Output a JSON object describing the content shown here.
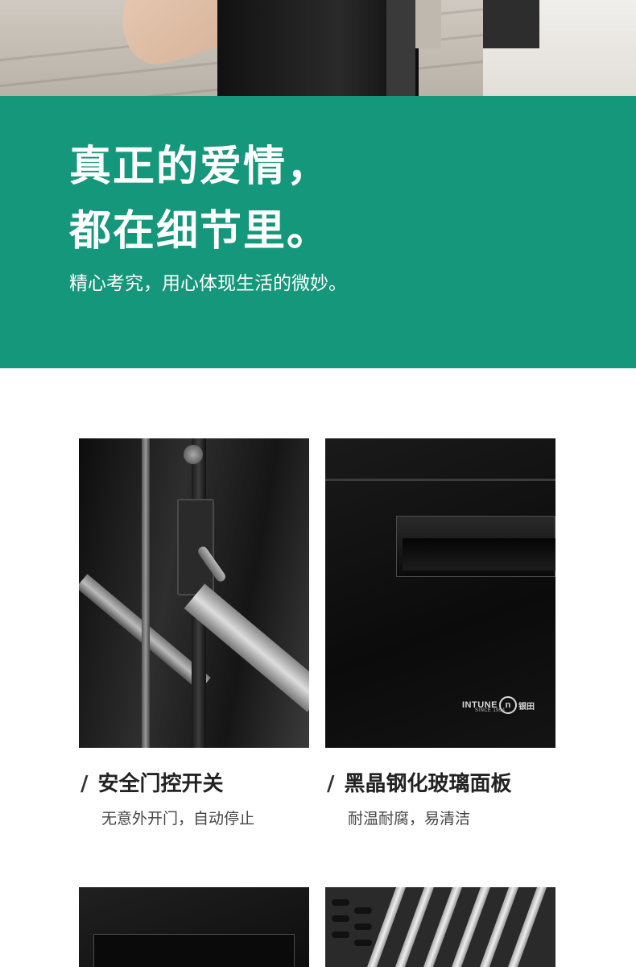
{
  "banner": {
    "headline_line1": "真正的爱情，",
    "headline_line2": "都在细节里。",
    "subline": "精心考究，用心体现生活的微妙。",
    "background_color": "#14977a"
  },
  "features": [
    {
      "title": "安全门控开关",
      "subtitle": "无意外开门，自动停止",
      "slash": "/"
    },
    {
      "title": "黑晶钢化玻璃面板",
      "subtitle": "耐温耐腐，易清洁",
      "slash": "/"
    }
  ],
  "brand": {
    "name": "INTUNE",
    "badge": "n",
    "chinese": "银田",
    "since": "SINCE 1994"
  }
}
